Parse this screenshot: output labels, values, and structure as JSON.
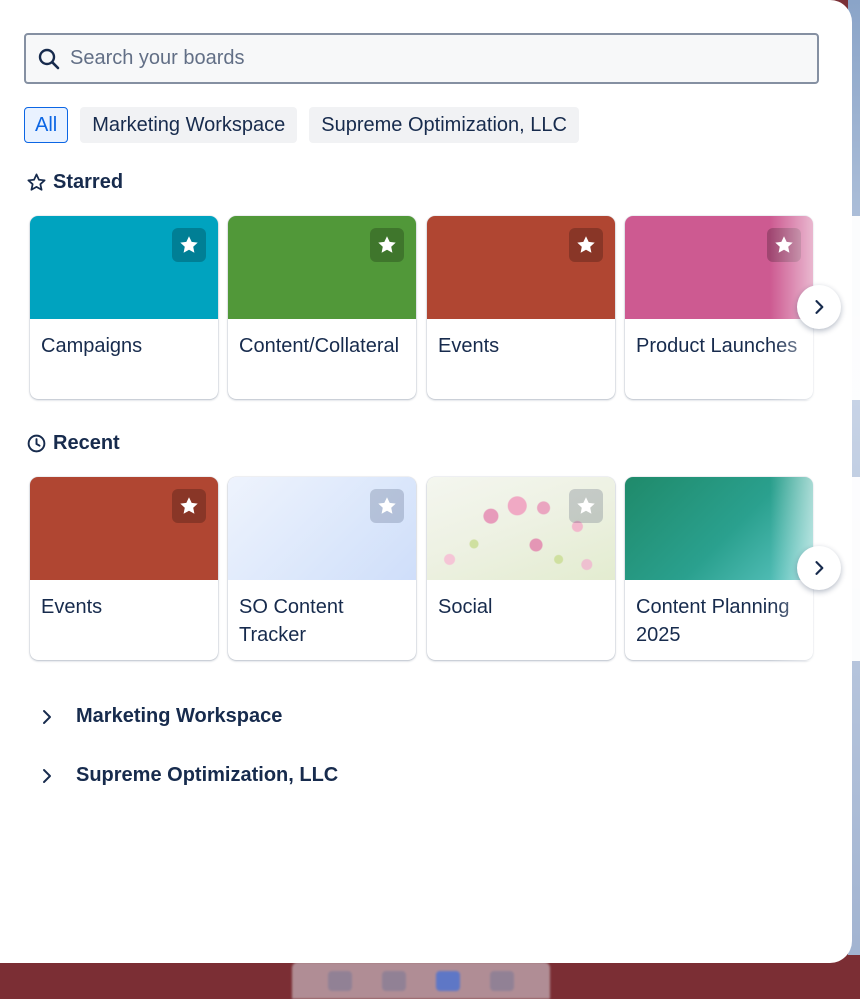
{
  "search": {
    "placeholder": "Search your boards",
    "value": ""
  },
  "filters": [
    {
      "label": "All",
      "active": true
    },
    {
      "label": "Marketing Workspace",
      "active": false
    },
    {
      "label": "Supreme Optimization, LLC",
      "active": false
    }
  ],
  "starred": {
    "title": "Starred",
    "icon": "star-outline-icon",
    "boards": [
      {
        "name": "Campaigns",
        "color": "#00a3bf",
        "starred": true
      },
      {
        "name": "Content/Collateral",
        "color": "#519839",
        "starred": true
      },
      {
        "name": "Events",
        "color": "#b04632",
        "starred": true
      },
      {
        "name": "Product Launches",
        "color": "#cd5a91",
        "starred": true
      }
    ]
  },
  "recent": {
    "title": "Recent",
    "icon": "clock-icon",
    "boards": [
      {
        "name": "Events",
        "color": "#b04632",
        "starred": true
      },
      {
        "name": "SO Content Tracker",
        "color": "#dbe7fb",
        "starred": false
      },
      {
        "name": "Social",
        "color": "photo-flowers",
        "starred": false
      },
      {
        "name": "Content Planning 2025",
        "color": "#1f8a70",
        "starred": false
      }
    ]
  },
  "workspaces": [
    {
      "name": "Marketing Workspace",
      "icon": "chevron-right-icon"
    },
    {
      "name": "Supreme Optimization, LLC",
      "icon": "chevron-right-icon"
    }
  ],
  "colors": {
    "accent": "#0c66e4",
    "text": "#172b4d",
    "placeholder": "#626f86"
  }
}
